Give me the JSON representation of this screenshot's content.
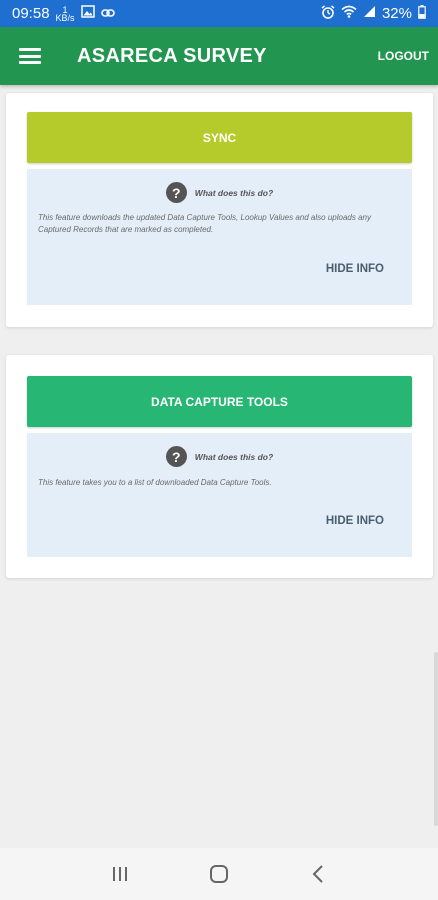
{
  "status_bar": {
    "time": "09:58",
    "net_speed": "1",
    "net_unit": "KB/s",
    "battery": "32%",
    "icons": [
      "image-icon",
      "link-icon",
      "alarm-icon",
      "wifi-icon",
      "signal-icon",
      "battery-icon"
    ]
  },
  "app_bar": {
    "title": "ASARECA SURVEY",
    "logout_label": "LOGOUT",
    "color": "#229650"
  },
  "cards": {
    "sync": {
      "button_label": "SYNC",
      "button_color": "#b5cb2b",
      "info_title": "What does this do?",
      "info_text": "This feature downloads the updated Data Capture Tools, Lookup Values and also uploads any Captured Records that are marked as completed.",
      "hide_label": "HIDE INFO"
    },
    "data_capture": {
      "button_label": "DATA CAPTURE TOOLS",
      "button_color": "#27b673",
      "info_title": "What does this do?",
      "info_text": "This feature takes you to a list of downloaded Data Capture Tools.",
      "hide_label": "HIDE INFO"
    }
  },
  "nav_bar": {
    "buttons": [
      "recent-apps-icon",
      "home-icon",
      "back-icon"
    ]
  }
}
